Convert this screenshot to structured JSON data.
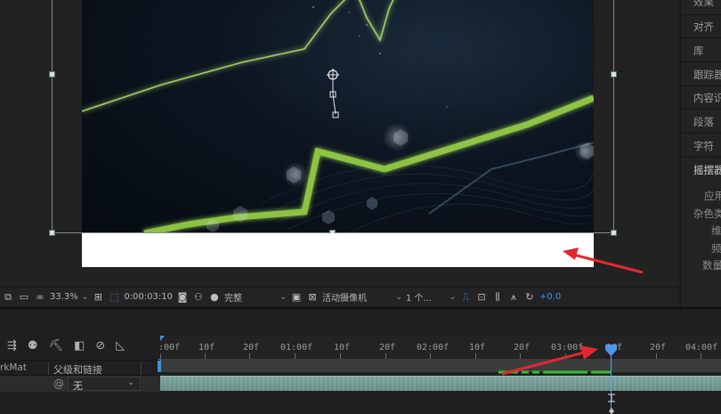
{
  "right_panel": {
    "items": [
      "效果",
      "对齐",
      "库",
      "跟踪器",
      "内容识",
      "段落",
      "字符",
      "摇摆器"
    ],
    "sub_items": [
      "应用",
      "杂色类",
      "维",
      "频",
      "数量"
    ]
  },
  "viewer_toolbar": {
    "zoom": "33.3%",
    "timecode": "0:00:03:10",
    "resolution": "完整",
    "camera": "活动摄像机",
    "views": "1 个...",
    "exposure": "+0.0"
  },
  "timeline": {
    "ruler_labels": [
      ":00f",
      "10f",
      "20f",
      "01:00f",
      "10f",
      "20f",
      "02:00f",
      "10f",
      "20f",
      "03:00f",
      "10f",
      "20f",
      "04:00f"
    ],
    "columns": {
      "trkmat": "rkMat",
      "parent": "父级和链接"
    },
    "layer": {
      "parent_value": "无"
    }
  },
  "colors": {
    "accent_blue": "#3d8ee8",
    "playhead": "#5aa0ff",
    "arrow_red": "#e0292f",
    "green_line": "#9cd64a",
    "keyframe_green": "#2fbf3a"
  }
}
